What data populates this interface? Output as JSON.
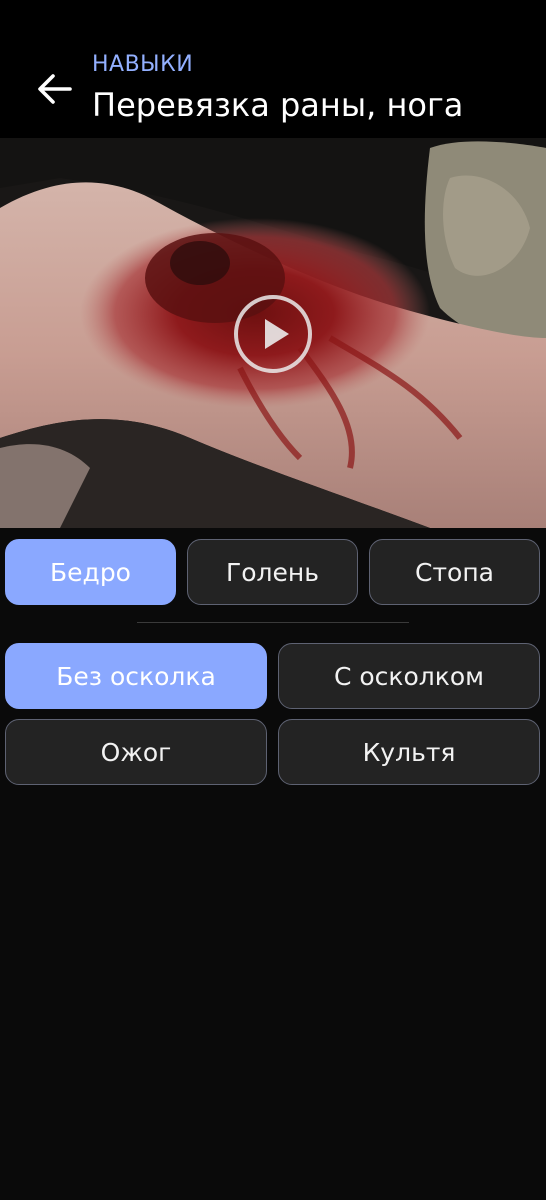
{
  "header": {
    "back_icon": "arrow-left-icon",
    "overline": "НАВЫКИ",
    "title": "Перевязка раны, нога"
  },
  "video": {
    "play_icon": "play-icon"
  },
  "region_tabs": [
    {
      "label": "Бедро",
      "active": true
    },
    {
      "label": "Голень",
      "active": false
    },
    {
      "label": "Стопа",
      "active": false
    }
  ],
  "wound_types": [
    {
      "label": "Без осколка",
      "active": true
    },
    {
      "label": "С осколком",
      "active": false
    },
    {
      "label": "Ожог",
      "active": false
    },
    {
      "label": "Культя",
      "active": false
    }
  ],
  "colors": {
    "accent": "#8aa8ff",
    "overline": "#93b0ff",
    "chip_bg": "#232323",
    "chip_border": "#5e6272",
    "background": "#0a0a0a"
  }
}
